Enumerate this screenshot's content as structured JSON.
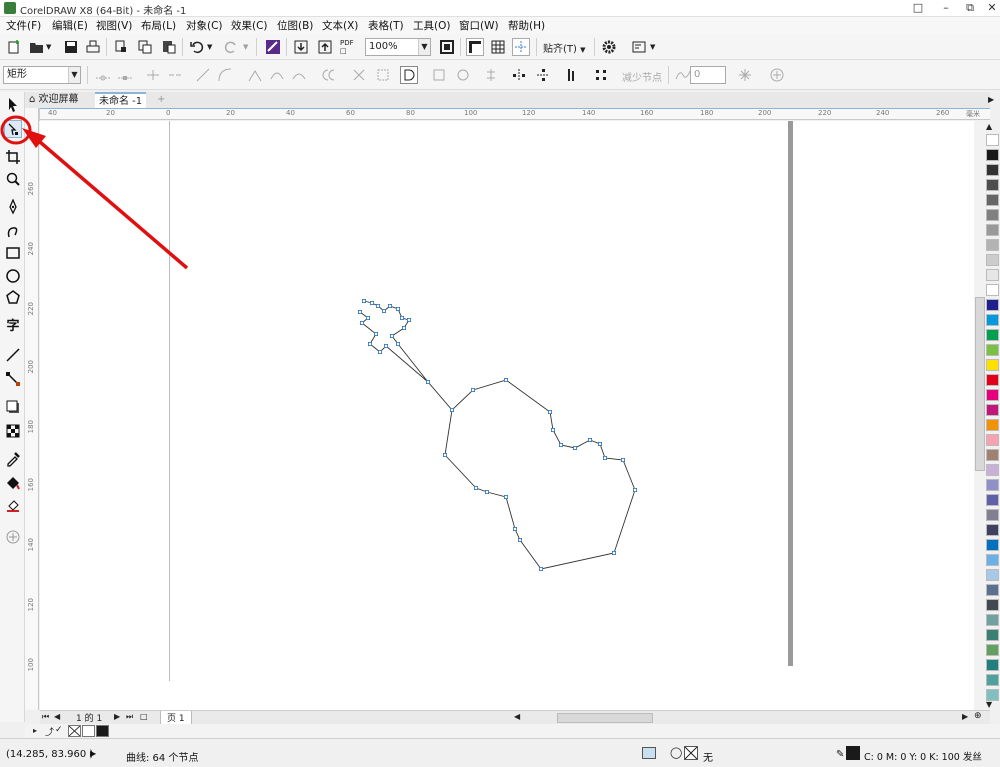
{
  "window": {
    "title": "CorelDRAW X8 (64-Bit) - 未命名 -1"
  },
  "menu": [
    "文件(F)",
    "编辑(E)",
    "视图(V)",
    "布局(L)",
    "对象(C)",
    "效果(C)",
    "位图(B)",
    "文本(X)",
    "表格(T)",
    "工具(O)",
    "窗口(W)",
    "帮助(H)"
  ],
  "toolbar": {
    "zoom_value": "100%",
    "snap_label": "贴齐(T)",
    "pdf_label": "PDF"
  },
  "property_bar": {
    "shape_select": "矩形",
    "reduce_nodes_label": "减少节点",
    "smooth_value": "0"
  },
  "tabs": {
    "welcome": "欢迎屏幕",
    "document": "未命名 -1"
  },
  "rulers": {
    "horizontal": [
      "40",
      "20",
      "0",
      "20",
      "40",
      "60",
      "80",
      "100",
      "120",
      "140",
      "160",
      "180",
      "200",
      "220",
      "240",
      "260"
    ],
    "unit": "毫米",
    "vertical": [
      "260",
      "240",
      "220",
      "200",
      "180",
      "160",
      "140",
      "120",
      "100"
    ]
  },
  "page_nav": {
    "page_of": "1 的 1",
    "page_tab": "页 1"
  },
  "status": {
    "coordinates": "(14.285, 83.960 )",
    "object_info": "曲线: 64 个节点",
    "fill_none": "无",
    "outline_info": "C: 0 M: 0 Y: 0 K: 100  发丝"
  },
  "colors": {
    "accent": "#2f7fd0",
    "annotation_red": "#e01010",
    "node_blue": "#2a6fb8",
    "palette": [
      "#ffffff",
      "#1a1a1a",
      "#333333",
      "#4d4d4d",
      "#666666",
      "#808080",
      "#999999",
      "#b3b3b3",
      "#cccccc",
      "#e6e6e6",
      "#ffffff",
      "#1f1f8f",
      "#0099dd",
      "#00a050",
      "#7ac143",
      "#ffe000",
      "#e3001b",
      "#e6007e",
      "#c0187a",
      "#f39200",
      "#f5a3b0",
      "#a08070",
      "#c8b0d8",
      "#9090c8",
      "#6060a8",
      "#808090",
      "#404060",
      "#0070c0",
      "#6cb0e8",
      "#a8c8e8",
      "#5a7090",
      "#404850",
      "#70a0a0",
      "#3a8070",
      "#60a060",
      "#208080",
      "#50a0a0",
      "#80c0c0"
    ]
  }
}
